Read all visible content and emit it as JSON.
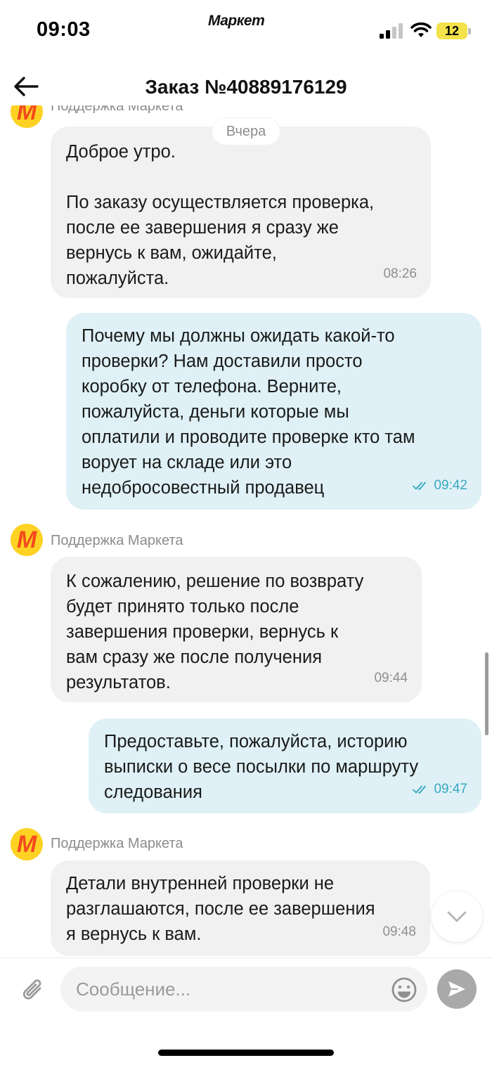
{
  "status_bar": {
    "time": "09:03",
    "app_name": "Маркет",
    "battery": "12"
  },
  "header": {
    "title": "Заказ №40889176129",
    "back_icon": "arrow-left-icon"
  },
  "chat": {
    "date_separator": "Вчера",
    "sender_name": "Поддержка Маркета",
    "avatar_letter": "М",
    "messages": [
      {
        "from": "support",
        "text": "Доброе утро.\n\nПо заказу осуществляется проверка,\nпосле ее завершения я сразу же\nвернусь к вам, ожидайте,\nпожалуйста.",
        "time": "08:26"
      },
      {
        "from": "user",
        "text": "Почему мы должны ожидать какой-то\nпроверки? Нам доставили просто\nкоробку от телефона. Верните,\nпожалуйста, деньги которые мы\nоплатили и проводите проверке кто там\nворует на складе или это\nнедобросовестный продавец",
        "time": "09:42",
        "read": true
      },
      {
        "from": "support",
        "text": "К сожалению, решение по возврату\nбудет принято только после\nзавершения проверки, вернусь к\nвам сразу же после получения\nрезультатов.",
        "time": "09:44"
      },
      {
        "from": "user",
        "text": "Предоставьте, пожалуйста, историю\nвыписки о весе посылки по маршруту\nследования",
        "time": "09:47",
        "read": true
      },
      {
        "from": "support",
        "text": "Детали внутренней проверки не\nразглашаются, после ее завершения\nя вернусь к вам.",
        "time": "09:48"
      }
    ]
  },
  "composer": {
    "placeholder": "Сообщение...",
    "value": "",
    "icons": [
      "paperclip-icon",
      "emoji-icon",
      "send-icon"
    ]
  },
  "colors": {
    "incoming_bubble": "#f1f1f1",
    "outgoing_bubble": "#dff1f6",
    "read_check": "#38a8c0",
    "brand_yellow": "#fdd223",
    "brand_red": "#f24a1e"
  }
}
